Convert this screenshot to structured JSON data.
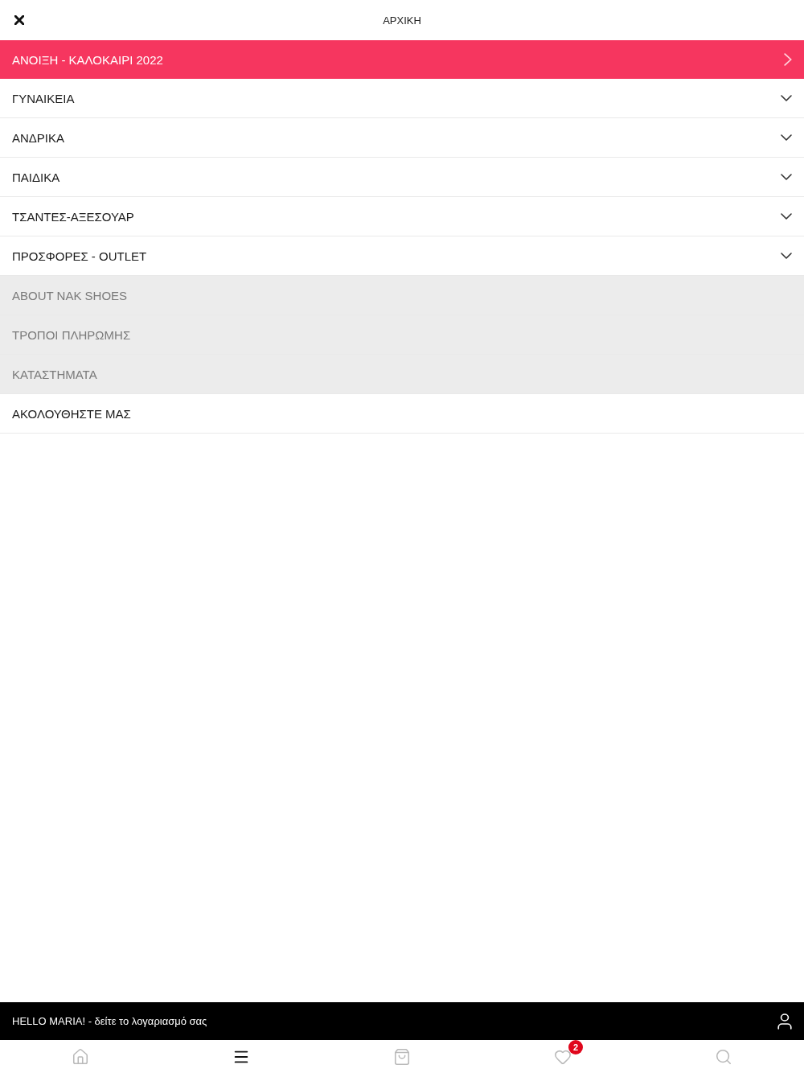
{
  "header": {
    "title": "ΑΡΧΙΚΗ"
  },
  "menu": [
    {
      "kind": "featured",
      "label": "ΑΝΟΙΞΗ - ΚΑΛΟΚΑΙΡΙ 2022"
    },
    {
      "kind": "category",
      "label": "ΓΥΝΑΙΚΕΙΑ",
      "expanded": false
    },
    {
      "kind": "category",
      "label": "ΑΝΔΡΙΚΑ",
      "expanded": false
    },
    {
      "kind": "category",
      "label": "ΠΑΙΔΙΚΑ",
      "expanded": false
    },
    {
      "kind": "category",
      "label": "ΤΣΑΝΤΕΣ-ΑΞΕΣΟΥΑΡ",
      "expanded": false
    },
    {
      "kind": "category",
      "label": "ΠΡΟΣΦΟΡΕΣ - OUTLET",
      "expanded": false
    },
    {
      "kind": "info",
      "label": "ABOUT NAK SHOES"
    },
    {
      "kind": "info",
      "label": "ΤΡΟΠΟΙ ΠΛΗΡΩΜΗΣ"
    },
    {
      "kind": "info",
      "label": "ΚΑΤΑΣΤΗΜΑΤΑ"
    },
    {
      "kind": "plain",
      "label": "ΑΚΟΛΟΥΘΗΣΤΕ ΜΑΣ"
    }
  ],
  "account_bar": {
    "text": "HELLO MARIA! - δείτε το λογαριασμό σας"
  },
  "bottom_nav": [
    {
      "kind": "home",
      "selected": false
    },
    {
      "kind": "menu",
      "selected": true
    },
    {
      "kind": "bag",
      "selected": false
    },
    {
      "kind": "heart",
      "selected": false,
      "badge": "2"
    },
    {
      "kind": "search",
      "selected": false
    }
  ]
}
